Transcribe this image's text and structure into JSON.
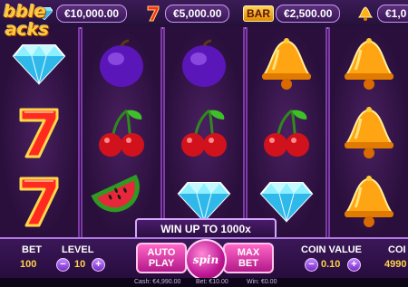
{
  "jackpots": [
    {
      "icon": "diamond-icon",
      "value": "€10,000.00"
    },
    {
      "icon": "seven-icon",
      "value": "€5,000.00"
    },
    {
      "icon": "bar-icon",
      "tag": "BAR",
      "value": "€2,500.00"
    },
    {
      "icon": "bell-icon",
      "value": "€1,0"
    }
  ],
  "logo": {
    "line1": "bble",
    "line2": "acks"
  },
  "reels": [
    [
      "diamond",
      "seven",
      "seven"
    ],
    [
      "plum",
      "cherry",
      "watermelon"
    ],
    [
      "plum",
      "cherry",
      "diamond"
    ],
    [
      "bell",
      "cherry",
      "diamond"
    ],
    [
      "bell",
      "bell",
      "bell"
    ]
  ],
  "win_banner": "WIN UP TO 1000x",
  "controls": {
    "bet_label": "BET",
    "bet_value": "100",
    "level_label": "LEVEL",
    "level_value": "10",
    "minus": "−",
    "plus": "+",
    "auto_play": "AUTO\nPLAY",
    "auto_line1": "AUTO",
    "auto_line2": "PLAY",
    "spin": "spin",
    "max_line1": "MAX",
    "max_line2": "BET",
    "coin_value_label": "COIN VALUE",
    "coin_value": "0.10",
    "coins_label": "COI",
    "coins_value": "4990"
  },
  "status": {
    "cash": "Cash: €4,990.00",
    "bet": "Bet: €10.00",
    "win": "Win: €0.00"
  },
  "colors": {
    "accent": "#b07be0",
    "gold": "#ffd24a",
    "pink": "#ff66c6"
  }
}
